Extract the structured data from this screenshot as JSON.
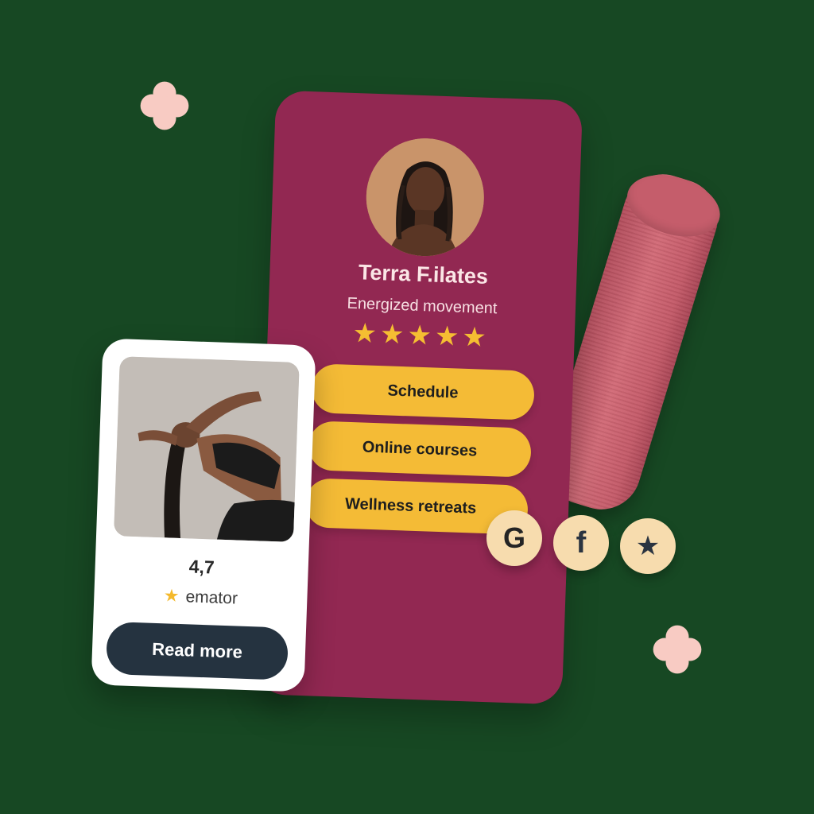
{
  "profile": {
    "name": "Terra F.ilates",
    "tagline": "Energized movement",
    "stars": "★★★★★"
  },
  "menu": [
    {
      "label": "Schedule"
    },
    {
      "label": "Online courses"
    },
    {
      "label": "Wellness retreats"
    }
  ],
  "social": [
    {
      "icon": "google-icon",
      "glyph": "G"
    },
    {
      "icon": "facebook-icon",
      "glyph": "f"
    },
    {
      "icon": "star-icon",
      "glyph": "★"
    }
  ],
  "review_card": {
    "rating_value": "4,7",
    "rating_source": "emator",
    "rating_star": "★",
    "button_label": "Read more"
  },
  "colors": {
    "background": "#174823",
    "profile_card": "#922852",
    "pill": "#f4bb36",
    "button": "#253340",
    "star": "#f5be32",
    "social_bg": "#f7dcae",
    "flower": "#f8cbc3"
  }
}
